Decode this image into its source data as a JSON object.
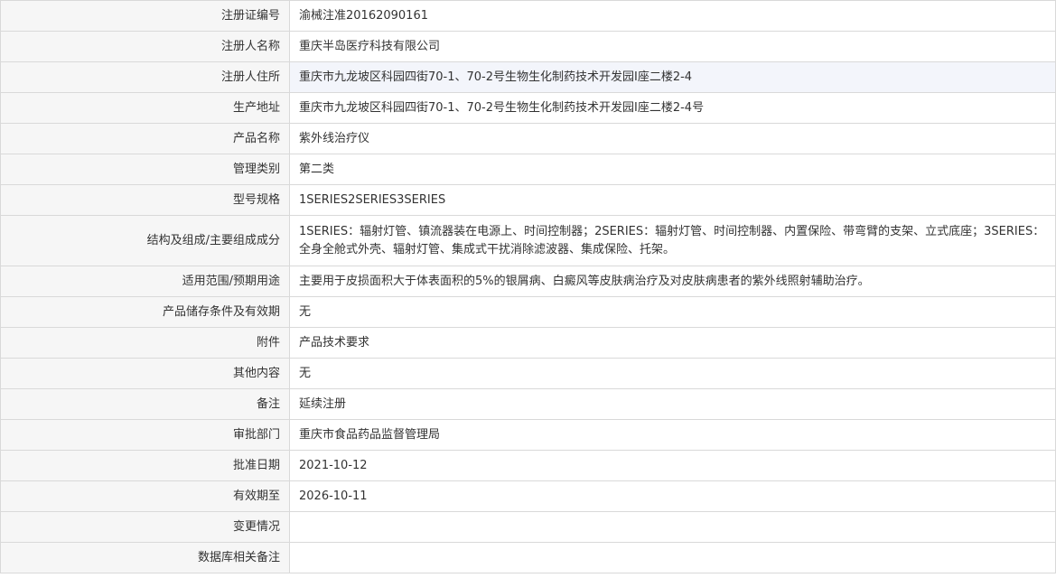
{
  "rows": [
    {
      "label": "注册证编号",
      "value": "渝械注准20162090161"
    },
    {
      "label": "注册人名称",
      "value": "重庆半岛医疗科技有限公司"
    },
    {
      "label": "注册人住所",
      "value": "重庆市九龙坡区科园四街70-1、70-2号生物生化制药技术开发园Ⅰ座二楼2-4"
    },
    {
      "label": "生产地址",
      "value": "重庆市九龙坡区科园四街70-1、70-2号生物生化制药技术开发园Ⅰ座二楼2-4号"
    },
    {
      "label": "产品名称",
      "value": "紫外线治疗仪"
    },
    {
      "label": "管理类别",
      "value": "第二类"
    },
    {
      "label": "型号规格",
      "value": "1SERIES2SERIES3SERIES"
    },
    {
      "label": "结构及组成/主要组成成分",
      "value": "1SERIES：辐射灯管、镇流器装在电源上、时间控制器；2SERIES：辐射灯管、时间控制器、内置保险、带弯臂的支架、立式底座；3SERIES：全身全舱式外壳、辐射灯管、集成式干扰消除滤波器、集成保险、托架。"
    },
    {
      "label": "适用范围/预期用途",
      "value": "主要用于皮损面积大于体表面积的5%的银屑病、白癜风等皮肤病治疗及对皮肤病患者的紫外线照射辅助治疗。"
    },
    {
      "label": "产品储存条件及有效期",
      "value": "无"
    },
    {
      "label": "附件",
      "value": "产品技术要求"
    },
    {
      "label": "其他内容",
      "value": "无"
    },
    {
      "label": "备注",
      "value": "延续注册"
    },
    {
      "label": "审批部门",
      "value": "重庆市食品药品监督管理局"
    },
    {
      "label": "批准日期",
      "value": "2021-10-12"
    },
    {
      "label": "有效期至",
      "value": "2026-10-11"
    },
    {
      "label": "变更情况",
      "value": ""
    },
    {
      "label": "数据库相关备注",
      "value": ""
    }
  ]
}
